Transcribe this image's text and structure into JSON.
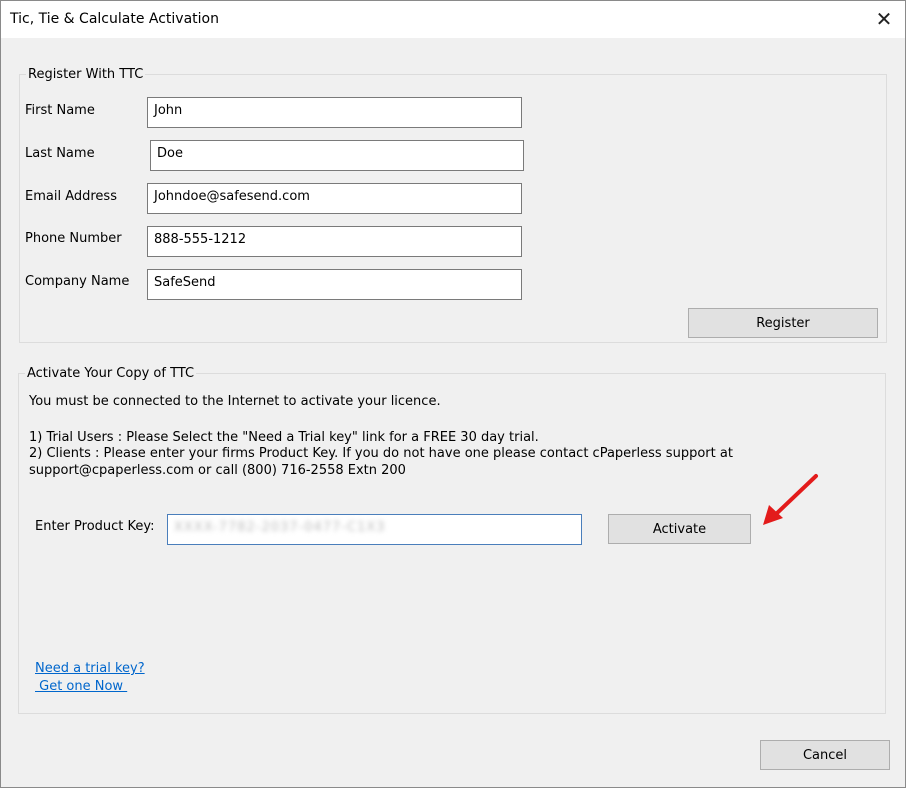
{
  "window": {
    "title": "Tic, Tie & Calculate Activation",
    "close_icon": "close-icon"
  },
  "register": {
    "legend": "Register With TTC",
    "fields": [
      {
        "label": "First Name",
        "value": "John"
      },
      {
        "label": "Last Name",
        "value": "Doe"
      },
      {
        "label": "Email Address",
        "value": "Johndoe@safesend.com"
      },
      {
        "label": "Phone Number",
        "value": "888-555-1212"
      },
      {
        "label": "Company Name",
        "value": "SafeSend"
      }
    ],
    "button": "Register"
  },
  "activate": {
    "legend": "Activate Your Copy of TTC",
    "line1": "You must be connected to the Internet to activate your licence.",
    "line2": "1) Trial Users : Please Select the \"Need a Trial key\" link for a FREE 30 day trial.",
    "line3": "2) Clients : Please enter your firms Product Key. If you do not have one please contact cPaperless support at support@cpaperless.com or call (800) 716-2558 Extn 200",
    "key_label": "Enter Product Key:",
    "key_value": "XXXX-7782-2037-0477-C1X3",
    "button": "Activate",
    "trial_link": "Need a trial key?",
    "get_link": " Get one Now ",
    "arrow_color": "#e31b1b"
  },
  "footer": {
    "cancel": "Cancel"
  }
}
